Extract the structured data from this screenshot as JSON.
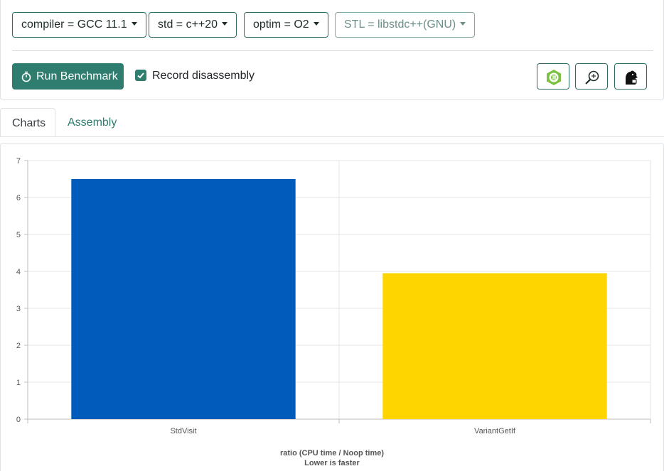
{
  "toolbar": {
    "compiler_label": "compiler = GCC 11.1",
    "std_label": "std = c++20",
    "optim_label": "optim = O2",
    "stl_label": "STL = libstdc++(GNU)",
    "run_label": "Run Benchmark",
    "record_label": "Record disassembly",
    "record_checked": true,
    "icons": [
      "timer-icon",
      "checkmark-icon",
      "cpp-logo-icon",
      "zoom-search-icon",
      "quick-bench-chicken-icon"
    ]
  },
  "tabs": [
    {
      "label": "Charts",
      "active": true
    },
    {
      "label": "Assembly",
      "active": false
    }
  ],
  "colors": {
    "accent": "#2e7d6f",
    "bar_stdvisit": "#005bbb",
    "bar_variantgetif": "#ffd500"
  },
  "chart_data": {
    "type": "bar",
    "categories": [
      "StdVisit",
      "VariantGetIf"
    ],
    "values": [
      6.5,
      3.95
    ],
    "colors": [
      "#005bbb",
      "#ffd500"
    ],
    "xlabel": "ratio (CPU time / Noop time)",
    "xlabel2": "Lower is faster",
    "ylim": [
      0,
      7
    ],
    "yticks": [
      "0",
      "1",
      "2",
      "3",
      "4",
      "5",
      "6",
      "7"
    ],
    "grid": true,
    "legend": "none"
  }
}
